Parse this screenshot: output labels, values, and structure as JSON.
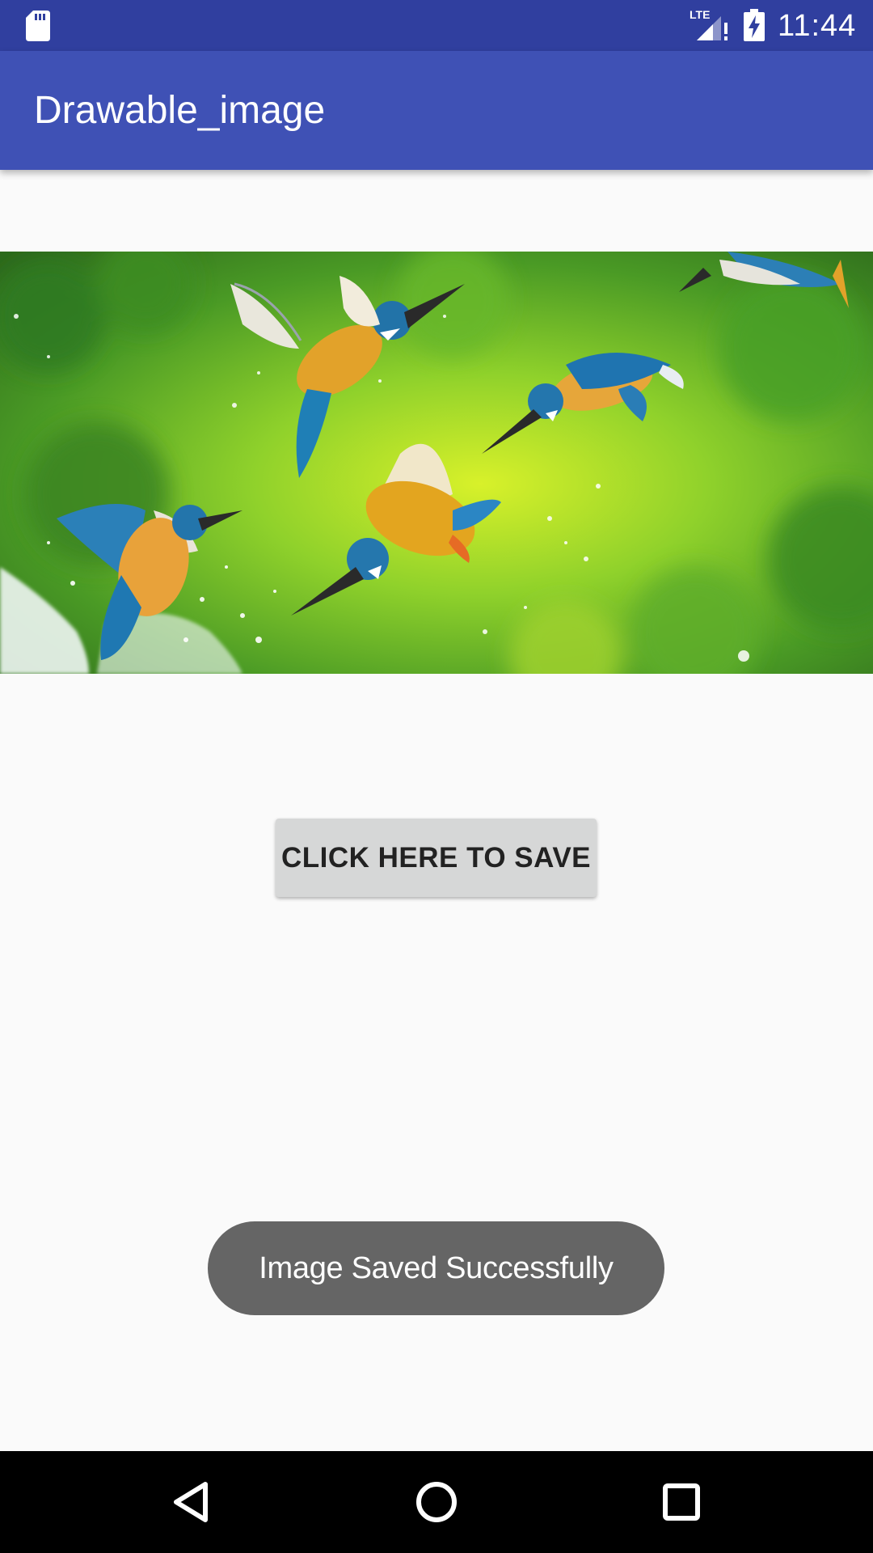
{
  "status_bar": {
    "time": "11:44",
    "network_label": "LTE",
    "icons": [
      "sd-card-icon",
      "lte-signal-icon",
      "battery-charging-icon"
    ]
  },
  "app_bar": {
    "title": "Drawable_image"
  },
  "hero_image": {
    "subject": "kingfishers-flying-over-water"
  },
  "save_button": {
    "label": "CLICK HERE TO SAVE"
  },
  "toast": {
    "message": "Image Saved Successfully"
  },
  "nav_bar": {
    "icons": [
      "back-icon",
      "home-icon",
      "recents-icon"
    ]
  },
  "colors": {
    "status_bar": "#303f9f",
    "app_bar": "#3f51b5",
    "background": "#fafafa",
    "button": "#d6d7d7",
    "toast": "#656565",
    "nav_bar": "#000000"
  }
}
